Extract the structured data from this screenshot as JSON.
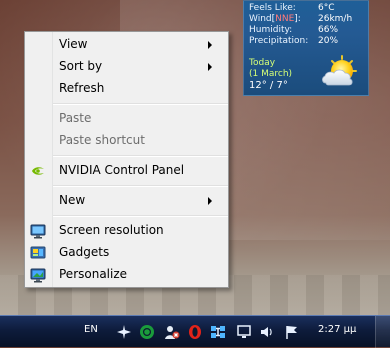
{
  "weather": {
    "rows": [
      {
        "label": "Feels Like:",
        "value": "6°C"
      },
      {
        "label_prefix": "Wind[",
        "label_mid": "NNE",
        "label_suffix": "]:",
        "value": "26km/h"
      },
      {
        "label": "Humidity:",
        "value": "66%"
      },
      {
        "label": "Precipitation:",
        "value": "20%"
      }
    ],
    "today": {
      "label": "Today",
      "date": "(1 March)",
      "temps": "12° / 7°"
    },
    "icon": "sun-cloud-icon"
  },
  "context_menu": {
    "items": [
      {
        "label": "View",
        "has_submenu": true,
        "enabled": true
      },
      {
        "label": "Sort by",
        "has_submenu": true,
        "enabled": true
      },
      {
        "label": "Refresh",
        "has_submenu": false,
        "enabled": true
      },
      {
        "label": "Paste",
        "has_submenu": false,
        "enabled": false
      },
      {
        "label": "Paste shortcut",
        "has_submenu": false,
        "enabled": false
      },
      {
        "label": "NVIDIA Control Panel",
        "has_submenu": false,
        "enabled": true,
        "icon": "nvidia-icon"
      },
      {
        "label": "New",
        "has_submenu": true,
        "enabled": true
      },
      {
        "label": "Screen resolution",
        "has_submenu": false,
        "enabled": true,
        "icon": "monitor-icon"
      },
      {
        "label": "Gadgets",
        "has_submenu": false,
        "enabled": true,
        "icon": "gadgets-icon"
      },
      {
        "label": "Personalize",
        "has_submenu": false,
        "enabled": true,
        "icon": "personalize-icon"
      }
    ]
  },
  "taskbar": {
    "language": "EN",
    "tray_icons": [
      "airplane-icon",
      "opera-green-icon",
      "user-status-icon",
      "opera-red-icon",
      "network-share-icon",
      "monitor-tray-icon",
      "volume-icon",
      "flag-icon"
    ],
    "clock": "2:27 μμ"
  },
  "colors": {
    "taskbar": "#0e1c3c",
    "weather_bg": "#245a93",
    "menu_bg": "#f0f0f0",
    "wind_direction": "#ff7a7a",
    "today_text": "#d6ff77"
  }
}
